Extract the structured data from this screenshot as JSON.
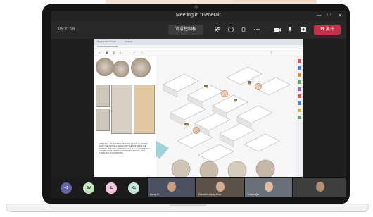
{
  "meeting": {
    "title": "Meeting in \"General\"",
    "timer": "05:31:28",
    "request_control": "请求控制权",
    "leave": "离开"
  },
  "window_controls": [
    "—",
    "□",
    "✕"
  ],
  "toolbar_icons": [
    "people-icon",
    "chat-icon",
    "raise-hand-icon",
    "more-icon",
    "camera-icon",
    "mic-icon",
    "share-icon"
  ],
  "browser": {
    "tabs": [
      "Week 6 Sketchbook",
      "Untitled"
    ],
    "address": "Adobe Acrobat Reader"
  },
  "doc_text": "GIVEN THE CONTINUOUS MERGING OF THE ACTIVITIES FROM THE CENTRAL AREAS AND THE BUILDINGS AND STREETS, THE LIVE INTERLINKAGES AND ACCESSIBILITY CONNECTIONS PROPOSE EXPANDED SPACES, NEW FORMS AND OCCUPATIONS...",
  "participants": {
    "avatars": [
      {
        "label": "+3",
        "color": "#6264a7"
      },
      {
        "label": "SV",
        "color": "#c7e9c0"
      },
      {
        "label": "IL",
        "color": "#f4c6e0"
      },
      {
        "label": "XL",
        "color": "#c6e8dc"
      }
    ],
    "videos": [
      {
        "name": "Liang Ye"
      },
      {
        "name": "Elizabeth Alpay-Chiu"
      },
      {
        "name": "Yindan Qin"
      },
      {
        "name": ""
      }
    ]
  }
}
